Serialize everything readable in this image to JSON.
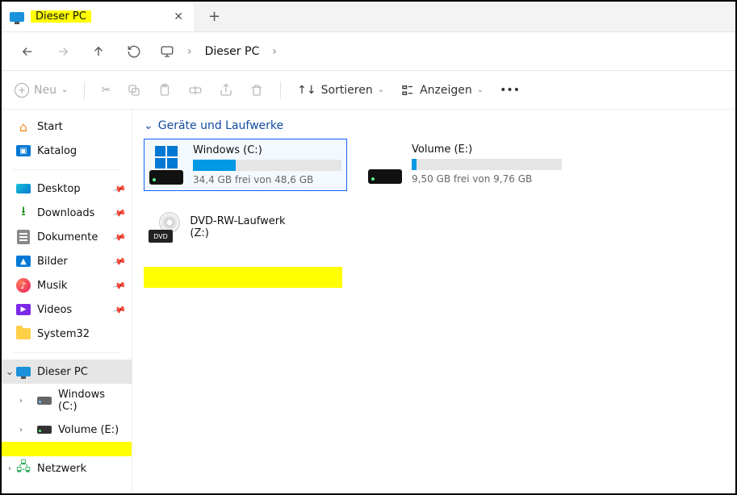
{
  "tab": {
    "title": "Dieser PC"
  },
  "breadcrumb": {
    "location": "Dieser PC"
  },
  "toolbar": {
    "new": "Neu",
    "sort": "Sortieren",
    "view": "Anzeigen"
  },
  "sidebar": {
    "start": "Start",
    "katalog": "Katalog",
    "desktop": "Desktop",
    "downloads": "Downloads",
    "dokumente": "Dokumente",
    "bilder": "Bilder",
    "musik": "Musik",
    "videos": "Videos",
    "system32": "System32",
    "thispc": "Dieser PC",
    "drivec": "Windows (C:)",
    "drivee": "Volume (E:)",
    "network": "Netzwerk"
  },
  "main": {
    "section": "Geräte und Laufwerke",
    "drives": [
      {
        "name": "Windows (C:)",
        "sub": "34,4 GB frei von 48,6 GB",
        "fill_percent": 29
      },
      {
        "name": "Volume (E:)",
        "sub": "9,50 GB frei von 9,76 GB",
        "fill_percent": 3
      }
    ],
    "dvd": {
      "name": "DVD-RW-Laufwerk (Z:)",
      "badge": "DVD"
    }
  }
}
